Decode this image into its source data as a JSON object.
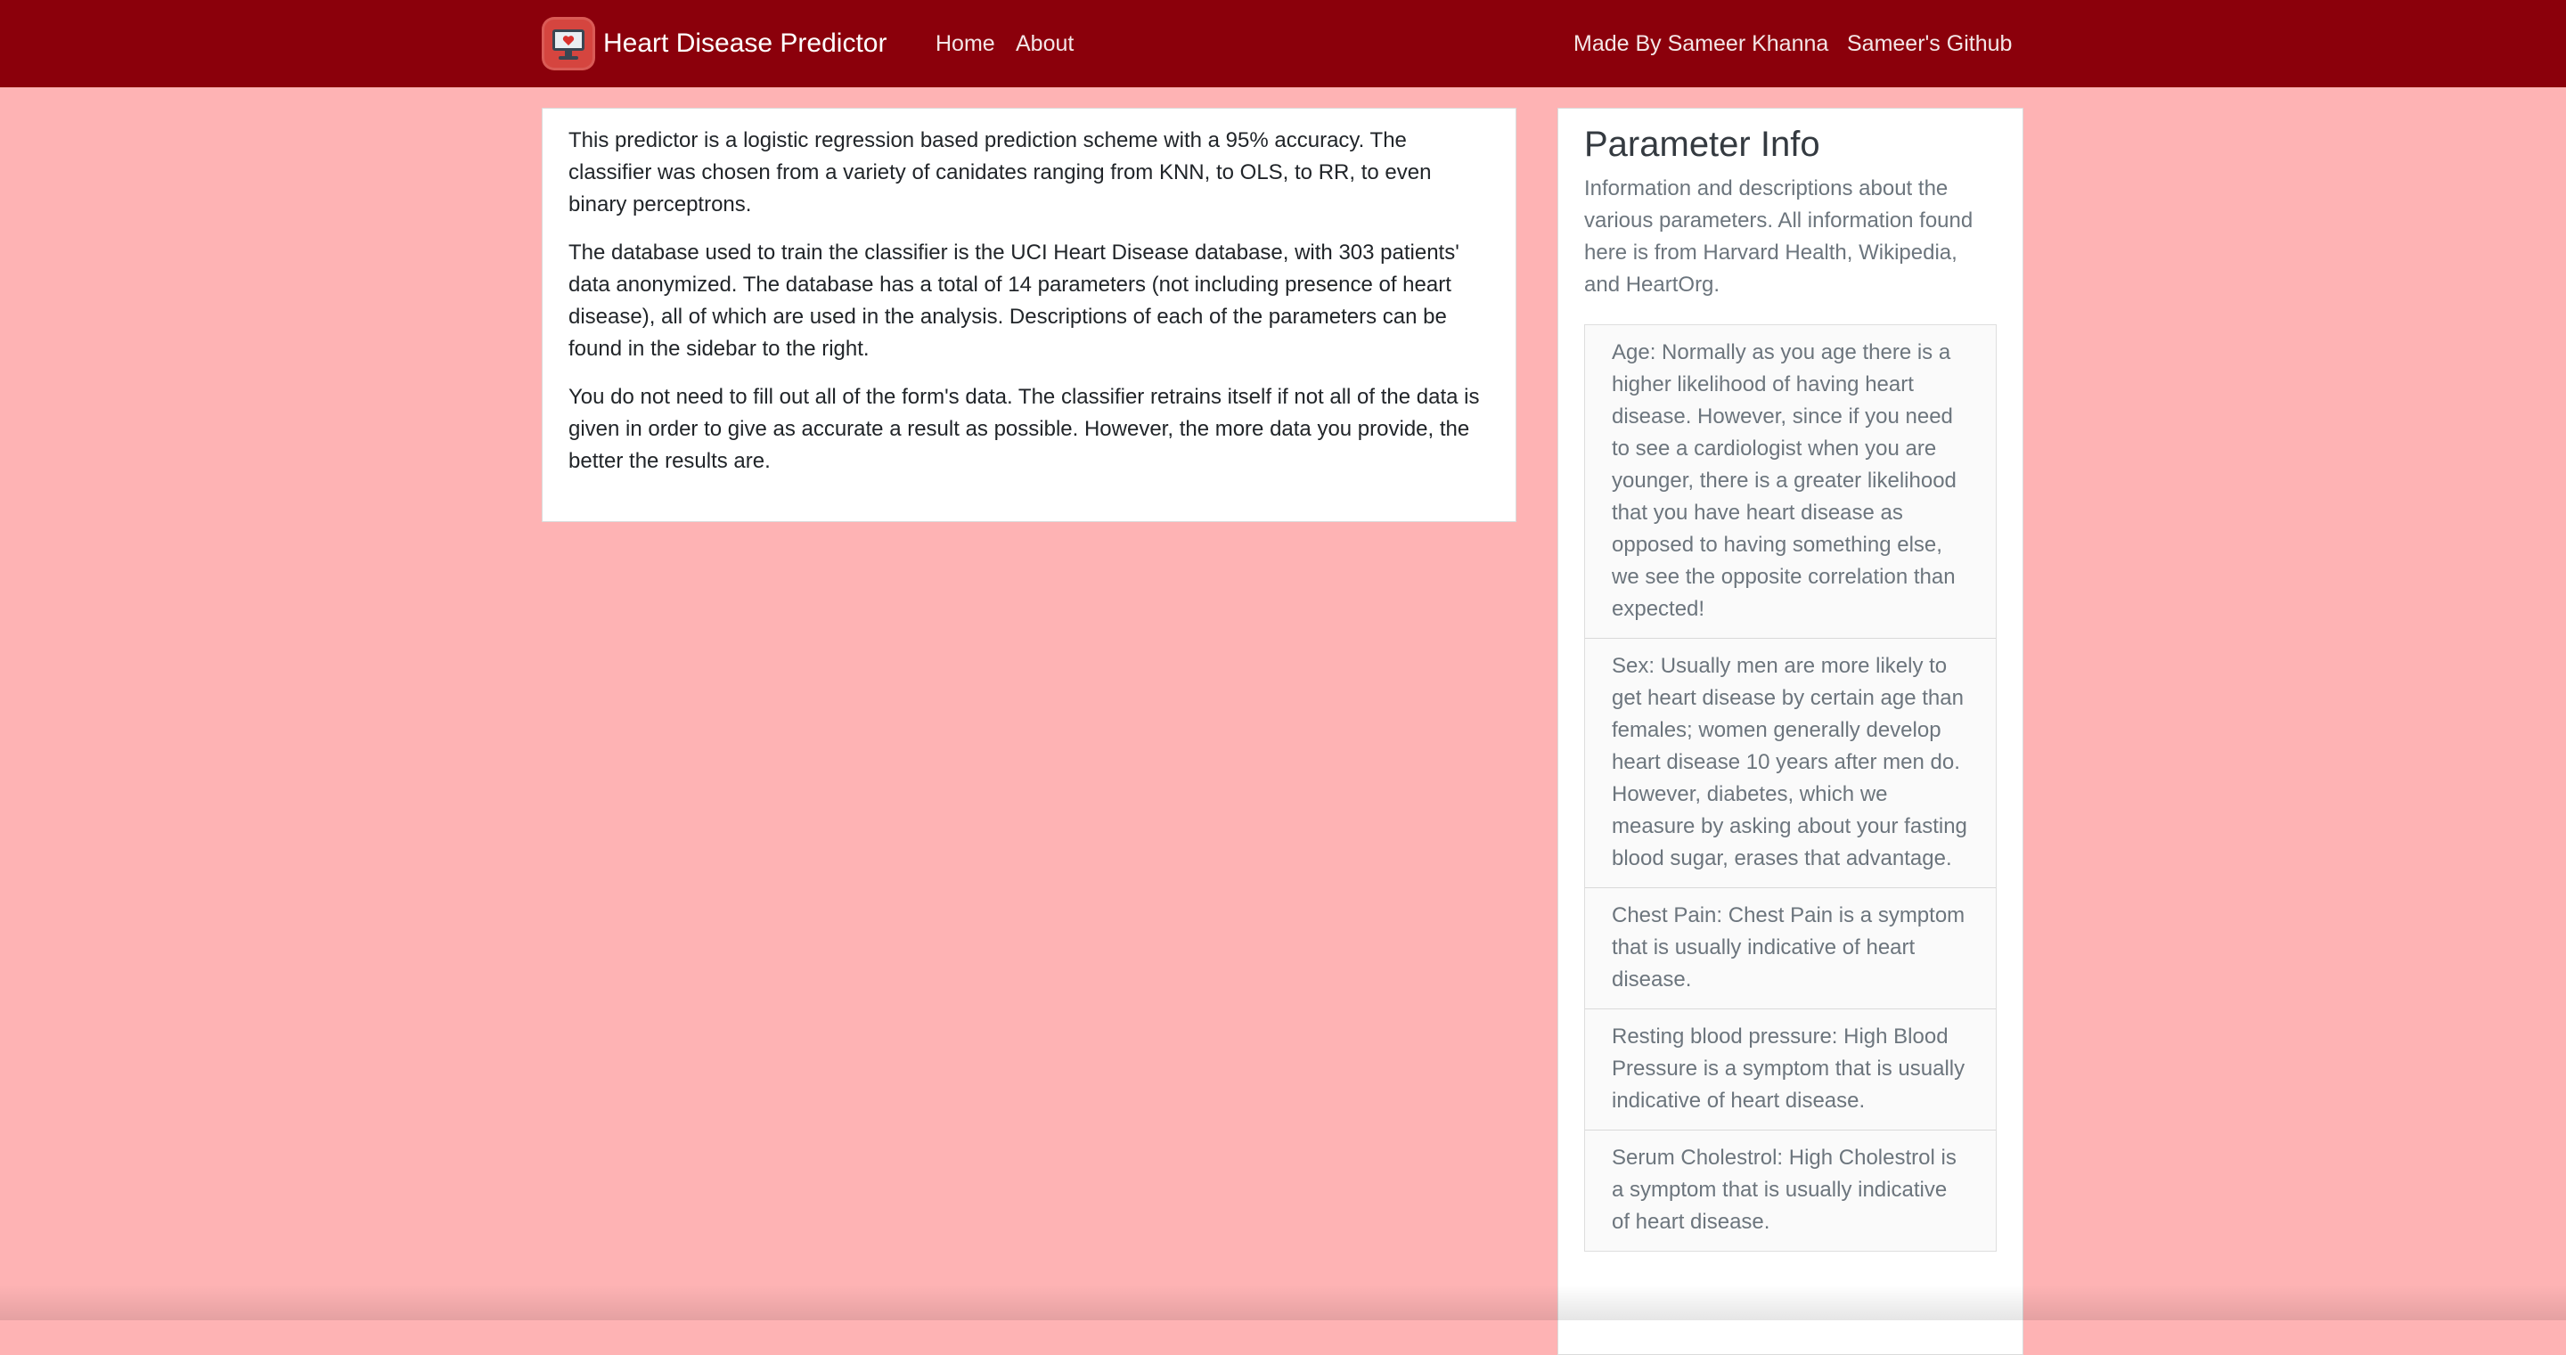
{
  "navbar": {
    "brand": "Heart Disease Predictor",
    "logo_icon": "heart-monitor-icon",
    "links": [
      {
        "label": "Home"
      },
      {
        "label": "About"
      }
    ],
    "right_links": [
      {
        "label": "Made By Sameer Khanna"
      },
      {
        "label": "Sameer's Github"
      }
    ]
  },
  "main": {
    "paragraphs": [
      "This predictor is a logistic regression based prediction scheme with a 95% accuracy. The classifier was chosen from a variety of canidates ranging from KNN, to OLS, to RR, to even binary perceptrons.",
      "The database used to train the classifier is the UCI Heart Disease database, with 303 patients' data anonymized. The database has a total of 14 parameters (not including presence of heart disease), all of which are used in the analysis. Descriptions of each of the parameters can be found in the sidebar to the right.",
      "You do not need to fill out all of the form's data. The classifier retrains itself if not all of the data is given in order to give as accurate a result as possible. However, the more data you provide, the better the results are."
    ]
  },
  "sidebar": {
    "title": "Parameter Info",
    "subtitle": "Information and descriptions about the various parameters. All information found here is from Harvard Health, Wikipedia, and HeartOrg.",
    "items": [
      "Age: Normally as you age there is a higher likelihood of having heart disease. However, since if you need to see a cardiologist when you are younger, there is a greater likelihood that you have heart disease as opposed to having something else, we see the opposite correlation than expected!",
      "Sex: Usually men are more likely to get heart disease by certain age than females; women generally develop heart disease 10 years after men do. However, diabetes, which we measure by asking about your fasting blood sugar, erases that advantage.",
      "Chest Pain: Chest Pain is a symptom that is usually indicative of heart disease.",
      "Resting blood pressure: High Blood Pressure is a symptom that is usually indicative of heart disease.",
      "Serum Cholestrol: High Cholestrol is a symptom that is usually indicative of heart disease."
    ]
  },
  "colors": {
    "navbar": "#8b000b",
    "background": "#feb3b4",
    "logo": "#d5453f"
  }
}
